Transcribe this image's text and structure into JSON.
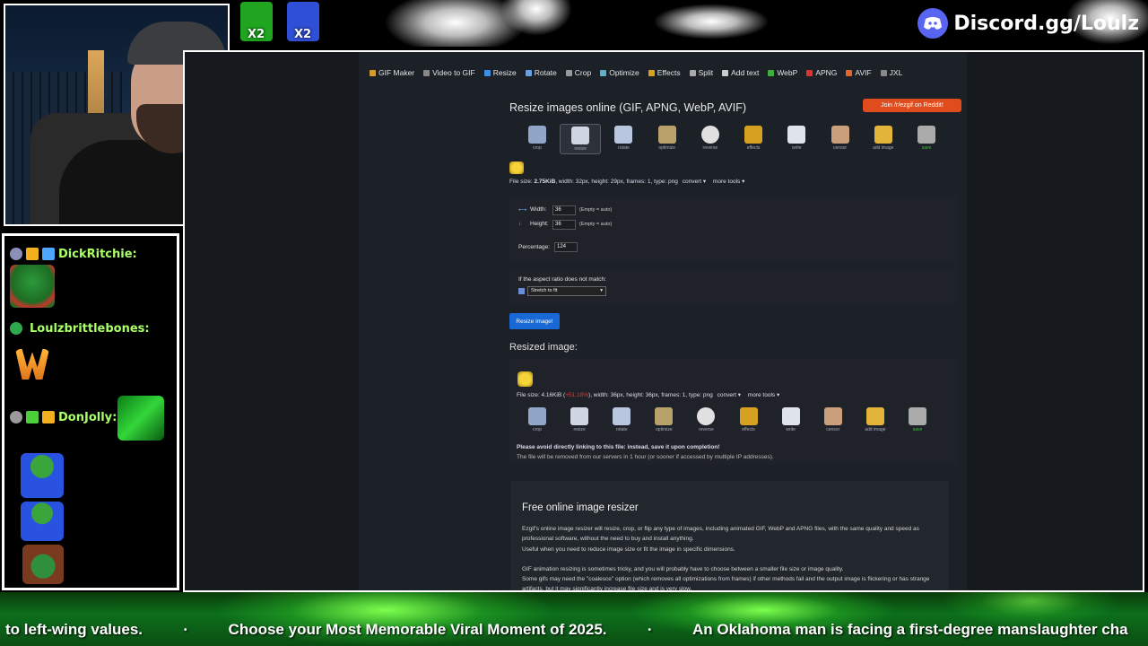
{
  "overlay": {
    "discord_label": "Discord.gg/Loulz",
    "top_emotes": [
      {
        "multiplier": "X2",
        "color": "#1fa51f"
      },
      {
        "multiplier": "X2",
        "color": "#2f4fd6"
      }
    ],
    "chat": [
      {
        "user": "DickRitchie:",
        "name_color": "#aaff66"
      },
      {
        "user": "Loulzbrittlebones:",
        "name_color": "#aaff66"
      },
      {
        "user": "DonJolly:",
        "name_color": "#aaff66"
      }
    ],
    "ticker": {
      "items": [
        "to left-wing values.",
        "Choose your Most Memorable Viral Moment of 2025.",
        "An Oklahoma man is facing a first-degree manslaughter cha"
      ],
      "separator": "•"
    }
  },
  "ezgif": {
    "nav": [
      {
        "label": "GIF Maker",
        "icon": "gif-maker-icon",
        "color": "#d39c2f"
      },
      {
        "label": "Video to GIF",
        "icon": "video-icon",
        "color": "#888"
      },
      {
        "label": "Resize",
        "icon": "resize-icon",
        "color": "#3a8ee6"
      },
      {
        "label": "Rotate",
        "icon": "rotate-icon",
        "color": "#6aa0e0"
      },
      {
        "label": "Crop",
        "icon": "crop-icon",
        "color": "#999"
      },
      {
        "label": "Optimize",
        "icon": "optimize-icon",
        "color": "#5fb0c9"
      },
      {
        "label": "Effects",
        "icon": "effects-icon",
        "color": "#d9a21e"
      },
      {
        "label": "Split",
        "icon": "split-icon",
        "color": "#aaa"
      },
      {
        "label": "Add text",
        "icon": "add-text-icon",
        "color": "#ccc"
      },
      {
        "label": "WebP",
        "icon": "webp-icon",
        "color": "#3fae3f"
      },
      {
        "label": "APNG",
        "icon": "apng-icon",
        "color": "#d33"
      },
      {
        "label": "AVIF",
        "icon": "avif-icon",
        "color": "#e0662c"
      },
      {
        "label": "JXL",
        "icon": "jxl-icon",
        "color": "#888"
      }
    ],
    "title": "Resize images online (GIF, APNG, WebP, AVIF)",
    "reddit_button": "Join /r/ezgif on Reddit!",
    "tools": [
      {
        "label": "crop",
        "color": "#8fa6c8"
      },
      {
        "label": "resize",
        "color": "#cfd6e2"
      },
      {
        "label": "rotate",
        "color": "#b8c6e0"
      },
      {
        "label": "optimize",
        "color": "#b9a16a"
      },
      {
        "label": "reverse",
        "color": "#e0e0e0"
      },
      {
        "label": "effects",
        "color": "#d6a020"
      },
      {
        "label": "write",
        "color": "#dfe4ea"
      },
      {
        "label": "censor",
        "color": "#c9a07a"
      },
      {
        "label": "add image",
        "color": "#e2b43a"
      },
      {
        "label": "save",
        "color": "#aaaaaa"
      }
    ],
    "file_info": {
      "prefix": "File size: ",
      "size": "2.75KiB",
      "rest": ", width: 32px, height: 29px, frames: 1, type: png",
      "convert": "convert ▾",
      "more_tools": "more tools ▾"
    },
    "form": {
      "width_label": "Width:",
      "width_value": "36",
      "height_label": "Height:",
      "height_value": "36",
      "auto_hint": "(Empty = auto)",
      "percentage_label": "Percentage:",
      "percentage_value": "124",
      "aspect_label": "If the aspect ratio does not match:",
      "aspect_option": "Stretch to fit"
    },
    "resize_button": "Resize image!",
    "resized_title": "Resized image:",
    "result_info": {
      "prefix": "File size: 4.16KiB (",
      "delta": "+51.18%",
      "rest": "), width: 36px, height: 36px, frames: 1, type: png",
      "convert": "convert ▾",
      "more_tools": "more tools ▾"
    },
    "notice_bold": "Please avoid directly linking to this file: instead, save it upon completion!",
    "notice": "The file will be removed from our servers in 1 hour (or sooner if accessed by multiple IP addresses).",
    "article": {
      "heading": "Free online image resizer",
      "p1": "Ezgif's online image resizer will resize, crop, or flip any type of images, including animated GIF, WebP and APNG files, with the same quality and speed as professional software, without the need to buy and install anything.",
      "p2": "Useful when you need to reduce image size or fit the image in specific dimensions.",
      "p3": "GIF animation resizing is sometimes tricky, and you will probably have to choose between a smaller file size or image quality.",
      "p4": "Some gifs may need the \"coalesce\" option (which removes all optimizations from frames) if other methods fail and the output image is flickering or has strange artifacts, but it may significantly increase file size and is very slow."
    }
  }
}
